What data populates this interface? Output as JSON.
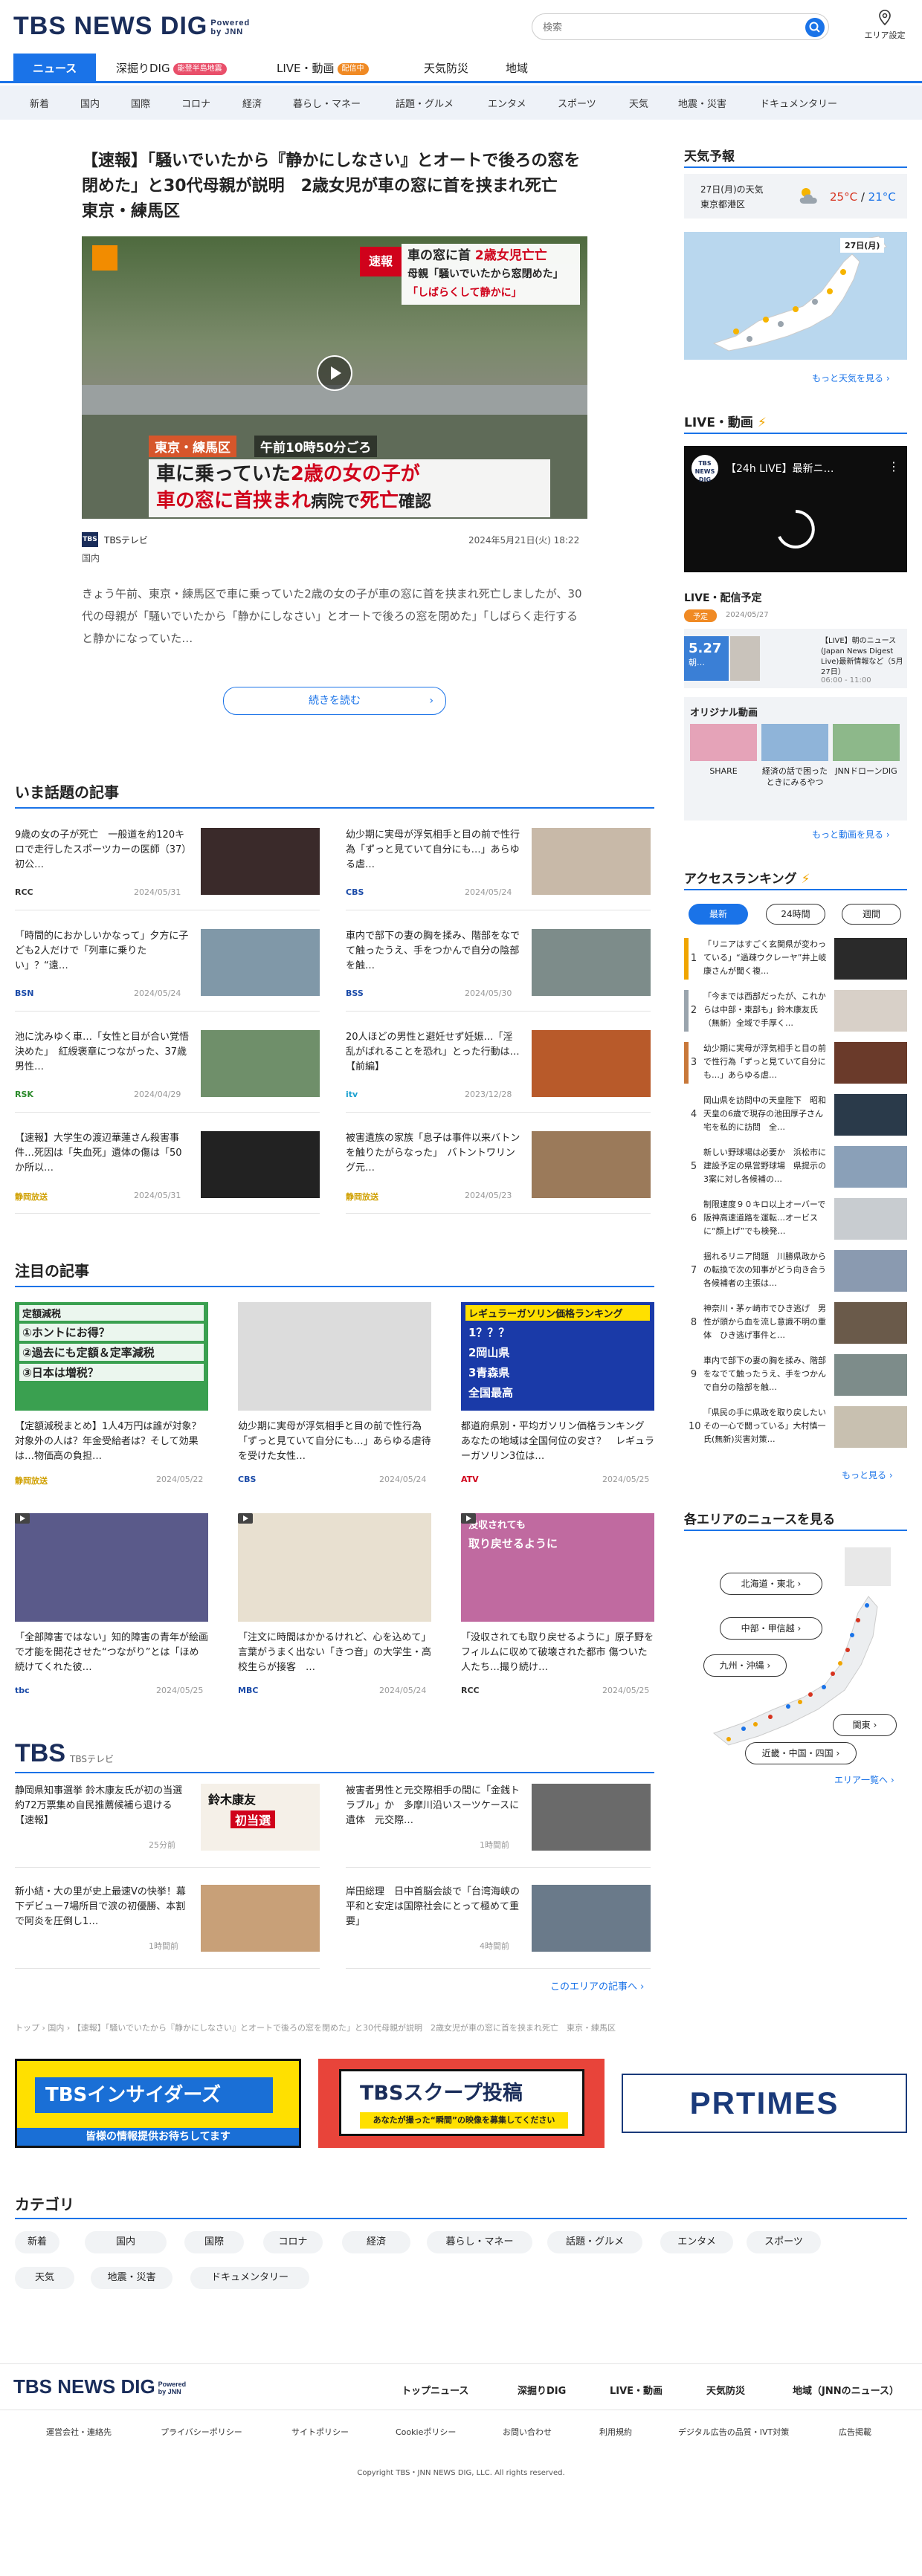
{
  "header": {
    "logo": "TBS NEWS DIG",
    "powered": "Powered",
    "by": "by JNN",
    "search_placeholder": "検索",
    "area_label": "エリア設定"
  },
  "nav": {
    "tabs": [
      {
        "label": "ニュース"
      },
      {
        "label": "深掘りDIG",
        "badge": "能登半島地震"
      },
      {
        "label": "LIVE・動画",
        "badge": "配信中"
      },
      {
        "label": "天気防災"
      },
      {
        "label": "地域"
      }
    ]
  },
  "subnav": [
    "新着",
    "国内",
    "国際",
    "コロナ",
    "経済",
    "暮らし・マネー",
    "話題・グルメ",
    "エンタメ",
    "スポーツ",
    "天気",
    "地震・災害",
    "ドキュメンタリー"
  ],
  "top": {
    "title": "【速報】「騒いでいたから『静かにしなさい』とオートで後ろの窓を閉めた」と30代母親が説明　2歳女児が車の窓に首を挟まれ死亡　東京・練馬区",
    "source": "TBSテレビ",
    "date": "2024年5月21日(火) 18:22",
    "category": "国内",
    "summary": "きょう午前、東京・練馬区で車に乗っていた2歳の女の子が車の窓に首を挟まれ死亡しましたが、30代の母親が「騒いでいたから「静かにしなさい」とオートで後ろの窓を閉めた」「しばらく走行すると静かになっていた…",
    "more": "続きを読む",
    "img": {
      "badge": "速報",
      "cap1": "車の窓に首",
      "cap1b": "2歳女児亡亡",
      "cap2": "母親「騒いでいたから窓閉めた」",
      "cap3": "「しばらくして静かに」",
      "loc": "東京・練馬区",
      "time": "午前10時50分ごろ",
      "big1a": "車に乗っていた",
      "big1b": "2歳の女の子が",
      "big2a": "車の窓に首挟まれ",
      "big2b": "病院で",
      "big2c": "死亡",
      "big2d": "確認"
    }
  },
  "trending": {
    "title": "いま話題の記事",
    "items": [
      {
        "title": "9歳の女の子が死亡　一般道を約120キロで走行したスポーツカーの医師（37）初公…",
        "src": "RCC",
        "date": "2024/05/31"
      },
      {
        "title": "幼少期に実母が浮気相手と目の前で性行為「ずっと見ていて自分にも…」あらゆる虐…",
        "src": "CBS",
        "date": "2024/05/24"
      },
      {
        "title": "「時間的におかしいかなって」夕方に子ども2人だけで「列車に乗りたい」？“遠…",
        "src": "BSN",
        "date": "2024/05/24"
      },
      {
        "title": "車内で部下の妻の胸を揉み、階部をなでて触ったうえ、手をつかんで自分の陰部を触…",
        "src": "BSS",
        "date": "2024/05/30"
      },
      {
        "title": "池に沈みゆく車…「女性と目が合い覚悟決めた」　紅綬褒章につながった、37歳男性…",
        "src": "RSK",
        "date": "2024/04/29"
      },
      {
        "title": "20人ほどの男性と避妊せず妊娠…「淫乱がばれることを恐れ」とった行動は…【前編】",
        "src": "itv",
        "date": "2023/12/28"
      },
      {
        "title": "【速報】大学生の渡辺華蓮さん殺害事件…死因は「失血死」遺体の傷は「50か所以…",
        "src": "静岡放送",
        "date": "2024/05/31"
      },
      {
        "title": "被害遺族の家族「息子は事件以来バトンを触りたがらなった」　バトントワリング元…",
        "src": "静岡放送",
        "date": "2024/05/23"
      }
    ]
  },
  "featured": {
    "title": "注目の記事",
    "items": [
      {
        "title": "【定額減税まとめ】1人4万円は誰が対象？対象外の人は？年金受給者は？そして効果は…物価高の負担…",
        "src": "静岡放送",
        "date": "2024/05/22",
        "imgtext": [
          "定額減税",
          "①ホントにお得？",
          "②過去にも定額＆定率減税",
          "③日本は増税？"
        ]
      },
      {
        "title": "幼少期に実母が浮気相手と目の前で性行為「ずっと見ていて自分にも…」あらゆる虐待を受けた女性…",
        "src": "CBS",
        "date": "2024/05/24"
      },
      {
        "title": "都道府県別・平均ガソリン価格ランキング　あなたの地域は全国何位の安さ？　レギュラーガソリン3位は…",
        "src": "ATV",
        "date": "2024/05/25",
        "imgtext": [
          "レギュラーガソリン価格ランキング",
          "1？？？",
          "2岡山県",
          "3青森県",
          "全国最高"
        ]
      },
      {
        "title": "「全部障害ではない」知的障害の青年が絵画で才能を開花させた“つながり”とは「ほめ続けてくれた彼…",
        "src": "tbc",
        "date": "2024/05/25"
      },
      {
        "title": "「注文に時間はかかるけれど、心を込めて」言葉がうまく出ない「きつ音」の大学生・高校生らが接客　…",
        "src": "MBC",
        "date": "2024/05/24"
      },
      {
        "title": "「没収されても取り戻せるように」原子野をフィルムに収めて破壊された都市 傷ついた人たち…撮り続け…",
        "src": "RCC",
        "date": "2024/05/25",
        "imgtext": [
          "没収されても",
          "取り戻せるように"
        ]
      }
    ]
  },
  "tbs": {
    "logo": "TBS",
    "sub": "TBSテレビ",
    "items": [
      {
        "title": "静岡県知事選挙 鈴木康友氏が初の当選　約72万票集め自民推薦候補ら退ける【速報】",
        "date": "25分前",
        "imgtext": [
          "鈴木康友",
          "初当選"
        ]
      },
      {
        "title": "被害者男性と元交際相手の間に「金銭トラブル」か　多摩川沿いスーツケースに遺体　元交際…",
        "date": "1時間前"
      },
      {
        "title": "新小結・大の里が史上最速Vの快挙！幕下デビュー7場所目で涙の初優勝、本割で阿炎を圧倒し1…",
        "date": "1時間前"
      },
      {
        "title": "岸田総理　日中首脳会談で「台湾海峡の平和と安定は国際社会にとって極めて重要」",
        "date": "4時間前"
      }
    ],
    "more": "このエリアの記事へ"
  },
  "breadcrumb": "トップ › 国内 › 【速報】「騒いでいたから『静かにしなさい』とオートで後ろの窓を閉めた」と30代母親が説明　2歳女児が車の窓に首を挟まれ死亡　東京・練馬区",
  "banners": {
    "b1": "TBSインサイダーズ",
    "b1sub": "皆様の情報提供お待ちしてます",
    "b2": "TBSスクープ投稿",
    "b2sub": "あなたが撮った“瞬間”の映像を募集してください",
    "b3": "PRTIMES"
  },
  "category": {
    "title": "カテゴリ",
    "items": [
      "新着",
      "国内",
      "国際",
      "コロナ",
      "経済",
      "暮らし・マネー",
      "話題・グルメ",
      "エンタメ",
      "スポーツ",
      "天気",
      "地震・災害",
      "ドキュメンタリー"
    ]
  },
  "footer": {
    "logo": "TBS NEWS DIG",
    "powered": "Powered",
    "by": "by JNN",
    "nav": [
      "トップニュース",
      "深掘りDIG",
      "LIVE・動画",
      "天気防災",
      "地域（JNNのニュース）"
    ],
    "links": [
      "運営会社・連絡先",
      "プライバシーポリシー",
      "サイトポリシー",
      "Cookieポリシー",
      "お問い合わせ",
      "利用規約",
      "デジタル広告の品質・IVT対策",
      "広告掲載"
    ],
    "copyright": "Copyright TBS・JNN NEWS DIG, LLC. All rights reserved."
  },
  "side": {
    "weather": {
      "title": "天気予報",
      "date": "27日(月)の天気",
      "area": "東京都港区",
      "hi": "25°C",
      "lo": "21°C",
      "map_date": "27日(月)",
      "more": "もっと天気を見る"
    },
    "live": {
      "title": "LIVE・動画",
      "video": "【24h LIVE】最新ニ…"
    },
    "schedule": {
      "title": "LIVE・配信予定",
      "tag": "予定",
      "date": "2024/05/27",
      "daynum": "5.27",
      "daylabel": "朝…",
      "text": "【LIVE】朝のニュース(Japan News Digest Live)最新情報など（5月27日）",
      "time": "06:00 - 11:00"
    },
    "original": {
      "title": "オリジナル動画",
      "items": [
        "SHARE",
        "経済の話で困ったときにみるやつ",
        "JNNドローンDIG"
      ],
      "more": "もっと動画を見る"
    },
    "ranking": {
      "title": "アクセスランキング",
      "tabs": [
        "最新",
        "24時間",
        "週間"
      ],
      "items": [
        "「リニアはすごく玄関県が変わっている」“過疎ウクレーヤ”井上岐康さんが聞く複…",
        "「今までは西部だったが、これからは中部・東部も」鈴木康友氏（無新）全域で手厚く…",
        "幼少期に実母が浮気相手と目の前で性行為「ずっと見ていて自分にも…」あらゆる虐…",
        "岡山県を訪問中の天皇陛下　昭和天皇の6歳で現存の池田厚子さん宅を私的に訪問　全…",
        "新しい野球場は必要か　浜松市に建設予定の県営野球場　県提示の3案に対し各候補の…",
        "制限速度９０キロ以上オーバーで阪神高速道路を運転…オービスに“顔上げ”でも検発…",
        "揺れるリニア問題　川勝県政からの転換で次の知事がどう向き合う　各候補者の主張は…",
        "神奈川・茅ヶ崎市でひき逃げ　男性が頭から血を流し意識不明の重体　ひき逃げ事件と…",
        "車内で部下の妻の胸を揉み、階部をなでて触ったうえ、手をつかんで自分の陰部を触…",
        "「県民の手に県政を取り戻したい その一心で闘っている」大村慎一氏(無新)災害対策…"
      ],
      "more": "もっと見る"
    },
    "areas": {
      "title": "各エリアのニュースを見る",
      "buttons": [
        "北海道・東北",
        "中部・甲信越",
        "九州・沖縄",
        "関東",
        "近畿・中国・四国"
      ],
      "more": "エリア一覧へ"
    }
  },
  "colors": {
    "brand": "#1a2d5a",
    "accent": "#1a73e8",
    "red": "#d0021b"
  }
}
